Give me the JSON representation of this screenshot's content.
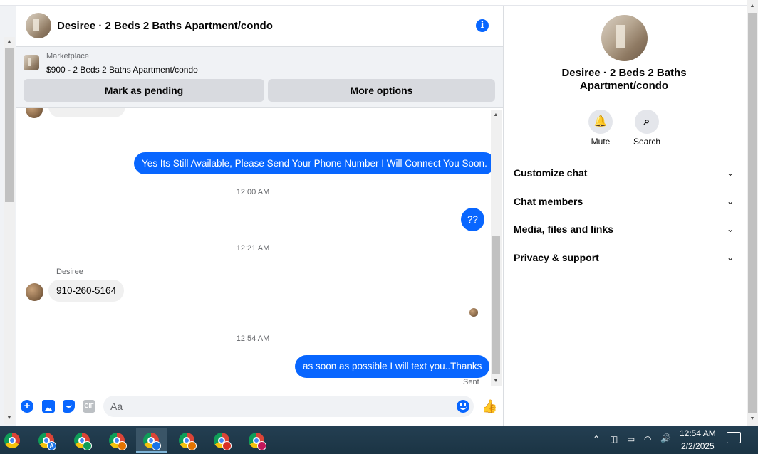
{
  "header": {
    "title": "Desiree · 2 Beds 2 Baths Apartment/condo",
    "info_icon": "i"
  },
  "marketplace": {
    "label": "Marketplace",
    "listing": "$900 - 2 Beds 2 Baths Apartment/condo",
    "mark_pending": "Mark as pending",
    "more_options": "More options"
  },
  "messages": {
    "msg1": "Yes Its Still Available, Please Send Your Phone Number I Will Connect You Soon.",
    "ts1": "12:00 AM",
    "msg2": "??",
    "ts2": "12:21 AM",
    "sender": "Desiree",
    "msg3": "910-260-5164",
    "ts3": "12:54 AM",
    "msg4": "as soon as possible I will text you..Thanks",
    "status": "Sent"
  },
  "composer": {
    "placeholder": "Aa",
    "gif": "GIF"
  },
  "right_panel": {
    "title": "Desiree · 2 Beds 2 Baths Apartment/condo",
    "mute": "Mute",
    "search": "Search",
    "sections": [
      "Customize chat",
      "Chat members",
      "Media, files and links",
      "Privacy & support"
    ]
  },
  "taskbar": {
    "time": "12:54 AM",
    "date": "2/2/2025",
    "profile_badge": "A"
  },
  "colors": {
    "accent": "#0866ff",
    "bubble_in": "#f0f0f0",
    "taskbar": "#1f3a4a"
  }
}
